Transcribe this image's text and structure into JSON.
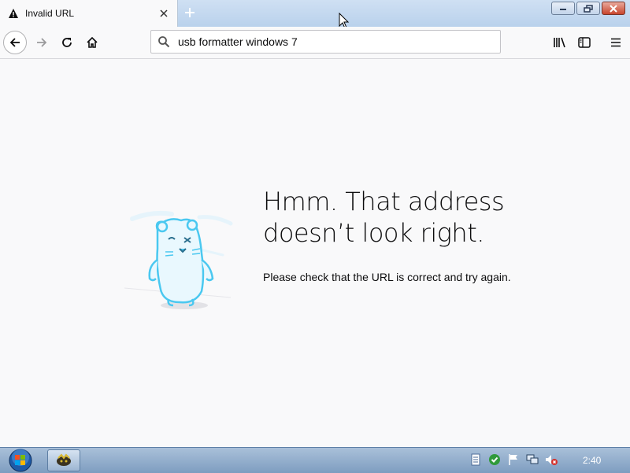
{
  "browser": {
    "tab": {
      "title": "Invalid URL",
      "icon": "warning-icon"
    },
    "new_tab_icon": "plus-icon",
    "window_buttons": [
      "minimize-icon",
      "restore-icon",
      "close-icon"
    ]
  },
  "toolbar": {
    "url_value": "usb formatter windows 7",
    "icons": [
      "back-arrow-icon",
      "forward-arrow-icon",
      "reload-icon",
      "home-icon",
      "search-icon",
      "library-icon",
      "sidebar-icon",
      "hamburger-menu-icon"
    ]
  },
  "error_page": {
    "title_line1": "Hmm. That address",
    "title_line2": "doesn’t look right.",
    "description": "Please check that the URL is correct and try again.",
    "illustration": "confused-hamster-illustration"
  },
  "taskbar": {
    "clock": "2:40",
    "tray_icons": [
      "notepad-icon",
      "security-check-icon",
      "action-center-flag-icon",
      "network-icon",
      "volume-muted-icon"
    ],
    "pinned": [
      "start-orb-icon",
      "app-icon"
    ]
  },
  "colors": {
    "titlebar": "#b9d1ec",
    "page_background": "#f9f9fa",
    "text": "#0c0c0d",
    "illustration_blue": "#4ac8f0",
    "taskbar": "#8fa9c8"
  }
}
